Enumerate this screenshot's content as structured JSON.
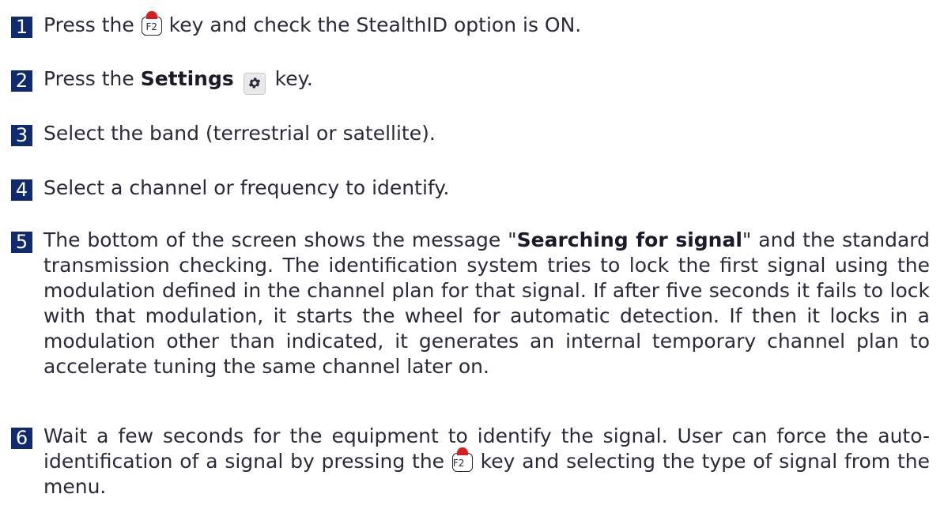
{
  "steps": [
    {
      "number": "1",
      "before": "Press the ",
      "key_label": "F2",
      "after": " key and check the StealthID option is ON."
    },
    {
      "number": "2",
      "before": "Press the ",
      "bold": "Settings",
      "icon": "gear-icon",
      "after": " key."
    },
    {
      "number": "3",
      "text": "Select the band (terrestrial or satellite)."
    },
    {
      "number": "4",
      "text": "Select a channel or frequency to identify."
    },
    {
      "number": "5",
      "before": "The bottom of the screen shows the message \"",
      "bold": "Searching for signal",
      "after": "\" and the standard transmission checking. The identification system tries to lock the first signal using the modulation defined in the channel plan for that signal. If after five seconds it fails to lock with that modulation, it starts the wheel for automatic detection. If then it locks in a modulation other than indicated, it generates an internal temporary channel plan to accelerate tuning the same channel later on."
    },
    {
      "number": "6",
      "before": "Wait a few seconds for the equipment to identify the signal. User can force the auto-identification of a signal by pressing the ",
      "key_label": "F2",
      "after": " key and selecting the type of signal from the menu."
    }
  ],
  "colors": {
    "number_badge_bg": "#0f2a6e",
    "text": "#2a2a3a",
    "key_dot": "#d42020"
  }
}
